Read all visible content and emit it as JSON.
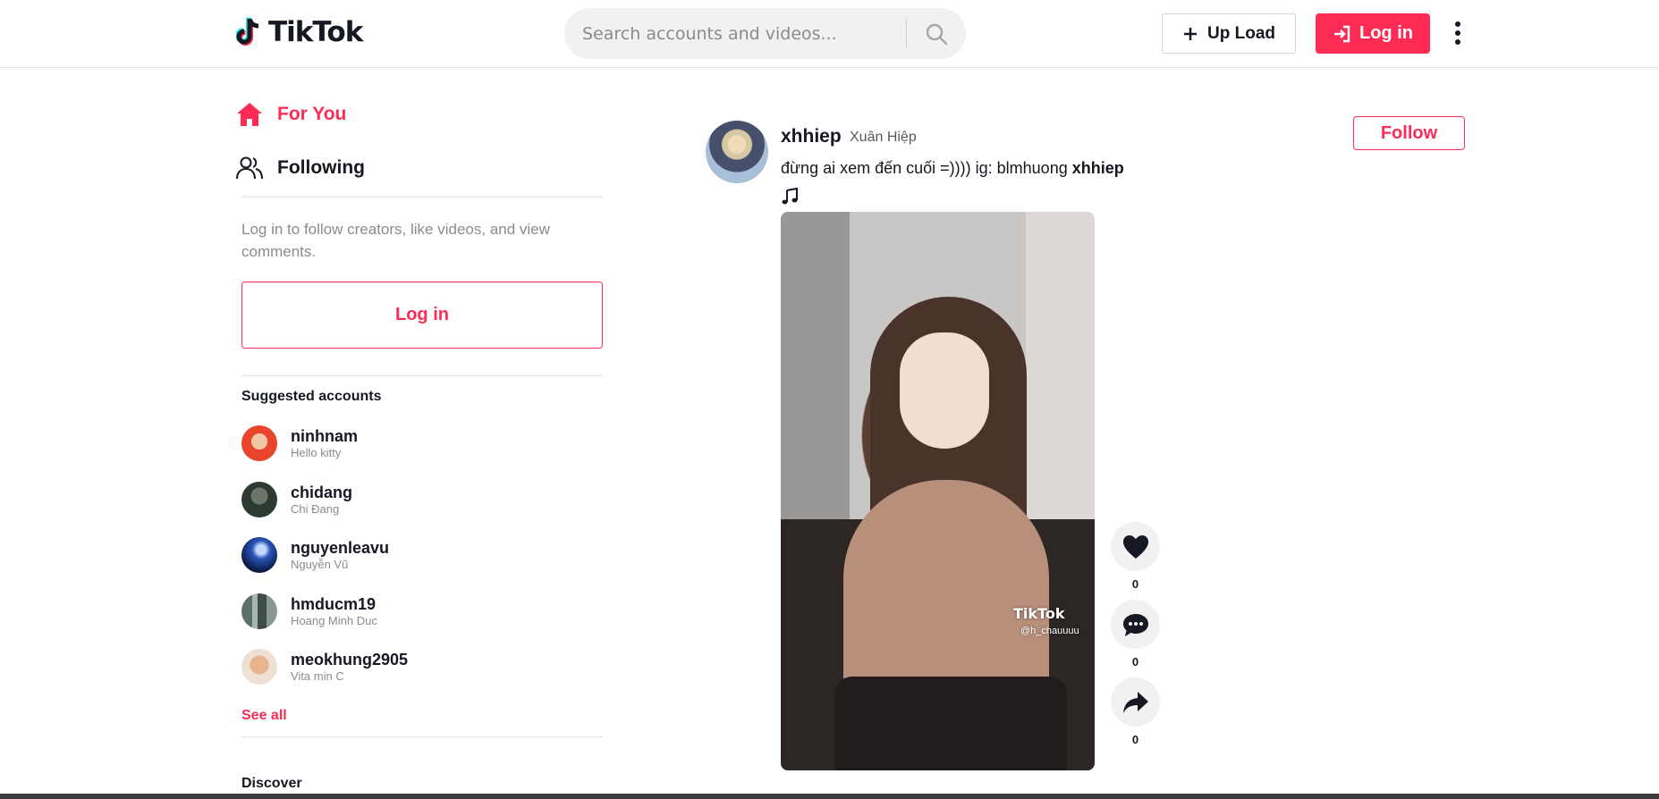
{
  "header": {
    "logo_text": "TikTok",
    "search_placeholder": "Search accounts and videos...",
    "upload_label": "Up Load",
    "login_label": "Log in"
  },
  "sidebar": {
    "nav": [
      {
        "label": "For You",
        "icon": "home-icon",
        "active": true
      },
      {
        "label": "Following",
        "icon": "users-icon",
        "active": false
      }
    ],
    "login_hint": "Log in to follow creators, like videos, and view comments.",
    "login_button": "Log in",
    "suggested_title": "Suggested accounts",
    "accounts": [
      {
        "username": "ninhnam",
        "name": "Hello kitty",
        "avatar_color": "#e8452c"
      },
      {
        "username": "chidang",
        "name": "Chi Đang",
        "avatar_color": "#3d4a3d"
      },
      {
        "username": "nguyenleavu",
        "name": "Nguyễn Vũ",
        "avatar_color": "#1d3f8f"
      },
      {
        "username": "hmducm19",
        "name": "Hoang Minh Duc",
        "avatar_color": "#7d8f86"
      },
      {
        "username": "meokhung2905",
        "name": "Vita min C",
        "avatar_color": "#e9cdb8"
      }
    ],
    "see_all": "See all",
    "discover_title": "Discover"
  },
  "post": {
    "username": "xhhiep",
    "nickname": "Xuân Hiệp",
    "caption_text": "đừng ai xem đến cuối =)))) ig: blmhuong ",
    "caption_tag": "xhhiep",
    "follow_label": "Follow",
    "watermark_brand": "TikTok",
    "watermark_user": "@h_chauuuu",
    "likes": "0",
    "comments": "0",
    "shares": "0"
  },
  "colors": {
    "accent": "#fe2c55",
    "text": "#161823",
    "muted": "#8a8b91"
  }
}
